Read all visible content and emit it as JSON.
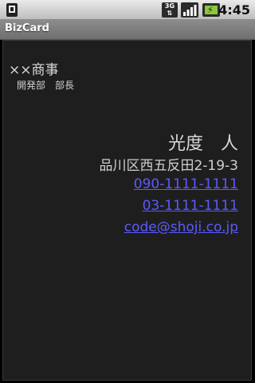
{
  "status_bar": {
    "time": "4:45",
    "network_label": "3G",
    "icons": [
      "sd-card-icon",
      "network-3g-icon",
      "signal-icon",
      "battery-icon"
    ]
  },
  "app": {
    "title": "BizCard"
  },
  "card": {
    "company": "××商事",
    "department": "開発部　部長",
    "name": "光度　人",
    "address": "品川区西五反田2-19-3",
    "phone_mobile": "090-1111-1111",
    "phone_office": "03-1111-1111",
    "email": "code@shoji.co.jp"
  },
  "colors": {
    "background": "#1e1e1e",
    "text": "#d8d8d8",
    "link": "#5a5aff",
    "title_bar": "#7a7a7a",
    "status_bar": "#d0d0d0"
  }
}
